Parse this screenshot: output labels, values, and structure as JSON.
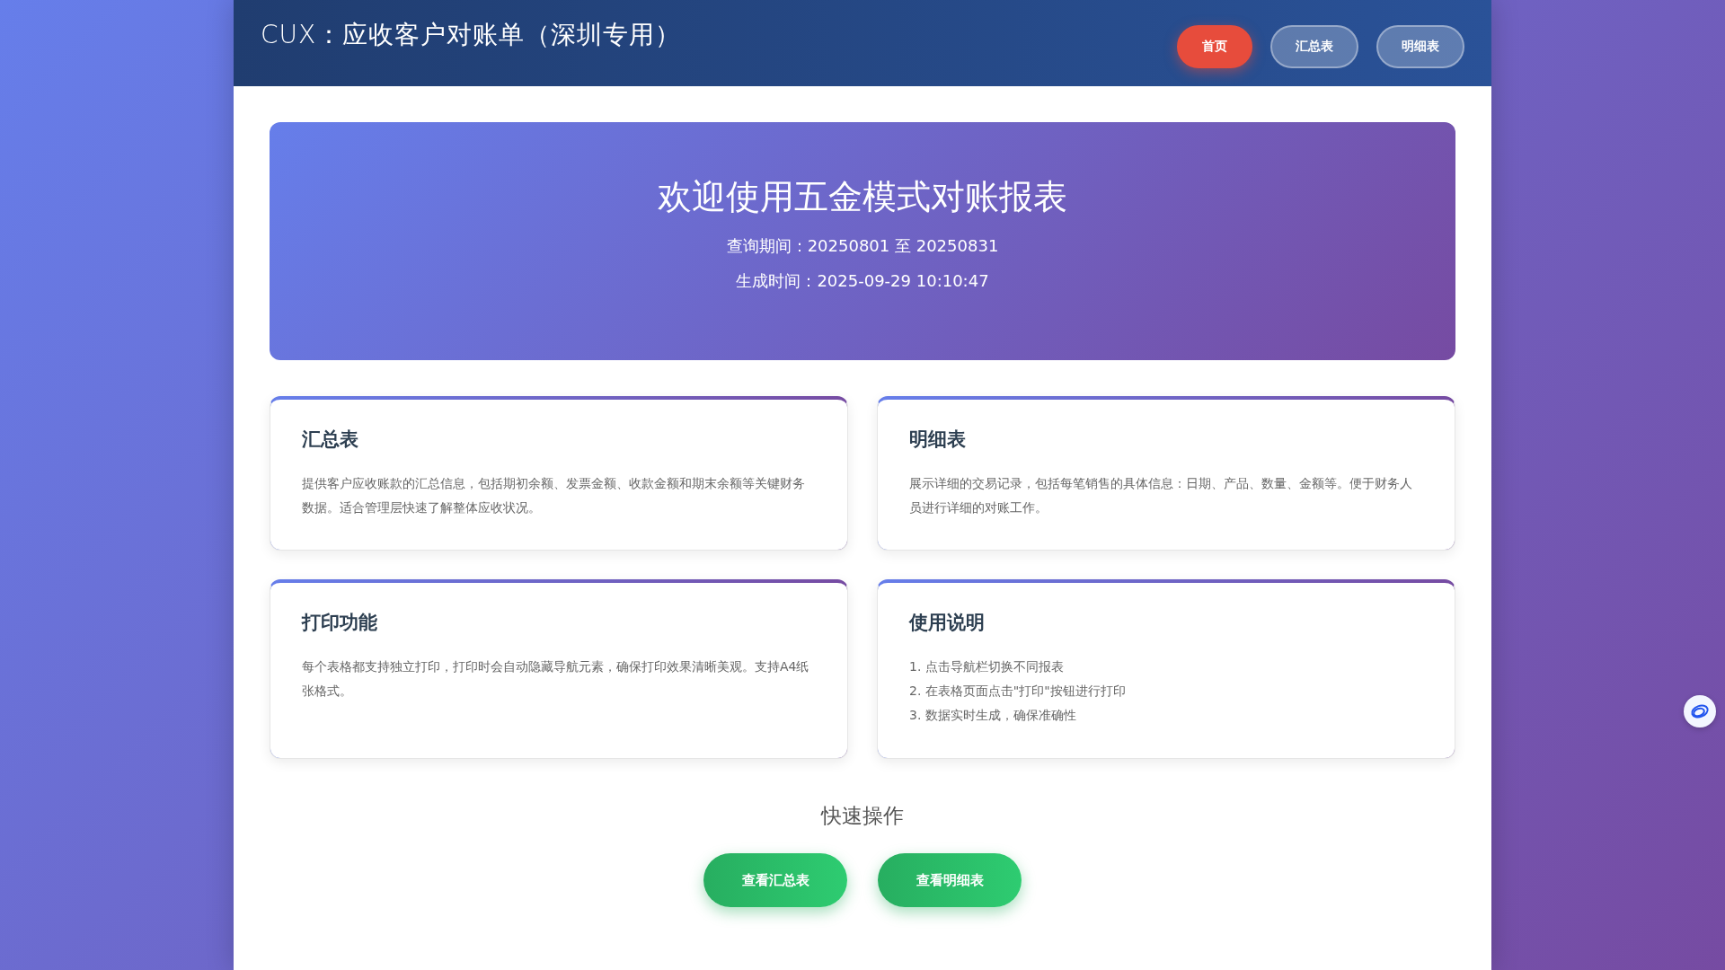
{
  "header": {
    "title": "CUX：应收客户对账单（深圳专用）",
    "nav": [
      {
        "label": "首页",
        "selected": true
      },
      {
        "label": "汇总表",
        "selected": false
      },
      {
        "label": "明细表",
        "selected": false
      }
    ]
  },
  "hero": {
    "title": "欢迎使用五金模式对账报表",
    "lines": [
      "查询期间：20250801 至 20250831",
      "生成时间：2025-09-29 10:10:47"
    ]
  },
  "cards": [
    {
      "kind": "text",
      "title": "汇总表",
      "body": "提供客户应收账款的汇总信息，包括期初余额、发票金额、收款金额和期末余额等关键财务数据。适合管理层快速了解整体应收状况。"
    },
    {
      "kind": "text",
      "title": "明细表",
      "body": "展示详细的交易记录，包括每笔销售的具体信息：日期、产品、数量、金额等。便于财务人员进行详细的对账工作。"
    },
    {
      "kind": "text",
      "title": "打印功能",
      "body": "每个表格都支持独立打印，打印时会自动隐藏导航元素，确保打印效果清晰美观。支持A4纸张格式。"
    },
    {
      "kind": "list",
      "title": "使用说明",
      "items": [
        "1. 点击导航栏切换不同报表",
        "2. 在表格页面点击\"打印\"按钮进行打印",
        "3. 数据实时生成，确保准确性"
      ]
    }
  ],
  "quick": {
    "title": "快速操作",
    "buttons": [
      "查看汇总表",
      "查看明细表"
    ]
  }
}
